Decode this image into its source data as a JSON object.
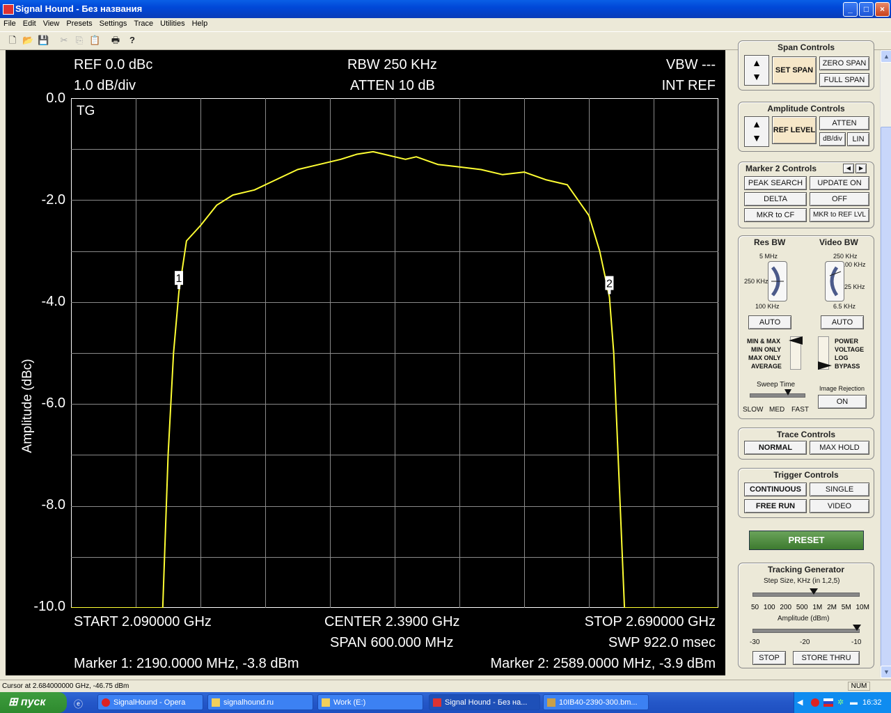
{
  "window": {
    "title": "Signal Hound - Без названия",
    "controls": [
      "_",
      "□",
      "×"
    ]
  },
  "menu": [
    "File",
    "Edit",
    "View",
    "Presets",
    "Settings",
    "Trace",
    "Utilities",
    "Help"
  ],
  "display": {
    "ref": "REF 0.0 dBc",
    "div": "1.0 dB/div",
    "rbw": "RBW 250 KHz",
    "atten": "ATTEN 10 dB",
    "vbw": "VBW ---",
    "intref": "INT REF",
    "tg": "TG",
    "start": "START 2.090000 GHz",
    "center": "CENTER 2.3900 GHz",
    "stop": "STOP 2.690000 GHz",
    "span": "SPAN 600.000 MHz",
    "swp": "SWP 922.0 msec",
    "marker1": "Marker 1: 2190.0000 MHz, -3.8 dBm",
    "marker2": "Marker 2: 2589.0000 MHz, -3.9 dBm",
    "ylabel": "Amplitude (dBc)",
    "yticks": [
      "0.0",
      "-2.0",
      "-4.0",
      "-6.0",
      "-8.0",
      "-10.0"
    ],
    "marker_tags": [
      "1",
      "2"
    ],
    "trace_color": "#FFFF33"
  },
  "chart_data": {
    "type": "line",
    "ylabel": "Amplitude (dBc)",
    "xlim": [
      2090,
      2690
    ],
    "ylim": [
      -10,
      0
    ],
    "y_ticks": [
      0,
      -2,
      -4,
      -6,
      -8,
      -10
    ],
    "grid": true,
    "series": [
      {
        "x": [
          2090,
          2175,
          2180,
          2185,
          2190,
          2197,
          2210,
          2225,
          2240,
          2260,
          2280,
          2300,
          2320,
          2340,
          2355,
          2370,
          2380,
          2390,
          2400,
          2410,
          2430,
          2450,
          2470,
          2490,
          2510,
          2530,
          2550,
          2570,
          2580,
          2585,
          2589,
          2593,
          2597,
          2603,
          2690
        ],
        "y": [
          -10,
          -10,
          -7.0,
          -5.0,
          -3.8,
          -2.8,
          -2.5,
          -2.1,
          -1.9,
          -1.8,
          -1.6,
          -1.4,
          -1.3,
          -1.2,
          -1.1,
          -1.05,
          -1.1,
          -1.15,
          -1.2,
          -1.15,
          -1.3,
          -1.35,
          -1.4,
          -1.5,
          -1.45,
          -1.6,
          -1.7,
          -2.3,
          -3.0,
          -3.5,
          -3.9,
          -5.0,
          -7.0,
          -10,
          -10
        ]
      }
    ],
    "markers": [
      {
        "label": "1",
        "x": 2190,
        "y": -3.8
      },
      {
        "label": "2",
        "x": 2589,
        "y": -3.9
      }
    ]
  },
  "panel": {
    "span": {
      "title": "Span Controls",
      "set_span": "SET SPAN",
      "zero_span": "ZERO SPAN",
      "full_span": "FULL SPAN"
    },
    "amplitude": {
      "title": "Amplitude Controls",
      "ref_level": "REF LEVEL",
      "atten": "ATTEN",
      "dbdiv": "dB/div",
      "lin": "LIN"
    },
    "marker2": {
      "title": "Marker 2 Controls",
      "peak": "PEAK SEARCH",
      "update": "UPDATE ON",
      "delta": "DELTA",
      "off": "OFF",
      "mkr_cf": "MKR to CF",
      "mkr_ref": "MKR to REF LVL"
    },
    "bw": {
      "res_title": "Res BW",
      "vid_title": "Video BW",
      "res_5m": "5 MHz",
      "res_250k": "250 KHz",
      "res_100k": "100 KHz",
      "vid_250k": "250 KHz",
      "vid_100k": "100 KHz",
      "vid_25k": "25 KHz",
      "vid_65k": "6.5 KHz",
      "auto1": "AUTO",
      "auto2": "AUTO",
      "detector": [
        "MIN & MAX",
        "MIN ONLY",
        "MAX ONLY",
        "AVERAGE"
      ],
      "mode": [
        "POWER",
        "VOLTAGE",
        "LOG",
        "BYPASS"
      ],
      "sweep_title": "Sweep Time",
      "slow": "SLOW",
      "med": "MED",
      "fast": "FAST",
      "imgrej_title": "Image Rejection",
      "imgrej": "ON"
    },
    "trace": {
      "title": "Trace Controls",
      "normal": "NORMAL",
      "maxhold": "MAX HOLD"
    },
    "trigger": {
      "title": "Trigger Controls",
      "continuous": "CONTINUOUS",
      "single": "SINGLE",
      "freerun": "FREE RUN",
      "video": "VIDEO"
    },
    "preset": "PRESET",
    "tracking": {
      "title": "Tracking Generator",
      "step": "Step Size, KHz (in 1,2,5)",
      "steps": [
        "50",
        "100",
        "200",
        "500",
        "1M",
        "2M",
        "5M",
        "10M"
      ],
      "amp": "Amplitude (dBm)",
      "amp_ticks": [
        "-30",
        "-20",
        "-10"
      ],
      "stop": "STOP",
      "store": "STORE THRU"
    }
  },
  "status": {
    "cursor": "Cursor at 2.684000000 GHz, -46.75 dBm",
    "num": "NUM"
  },
  "taskbar": {
    "start": "пуск",
    "tasks": [
      "SignalHound - Opera",
      "signalhound.ru",
      "Work (E:)",
      "Signal Hound - Без на...",
      "10IB40-2390-300.bm..."
    ],
    "clock": "16:32"
  }
}
